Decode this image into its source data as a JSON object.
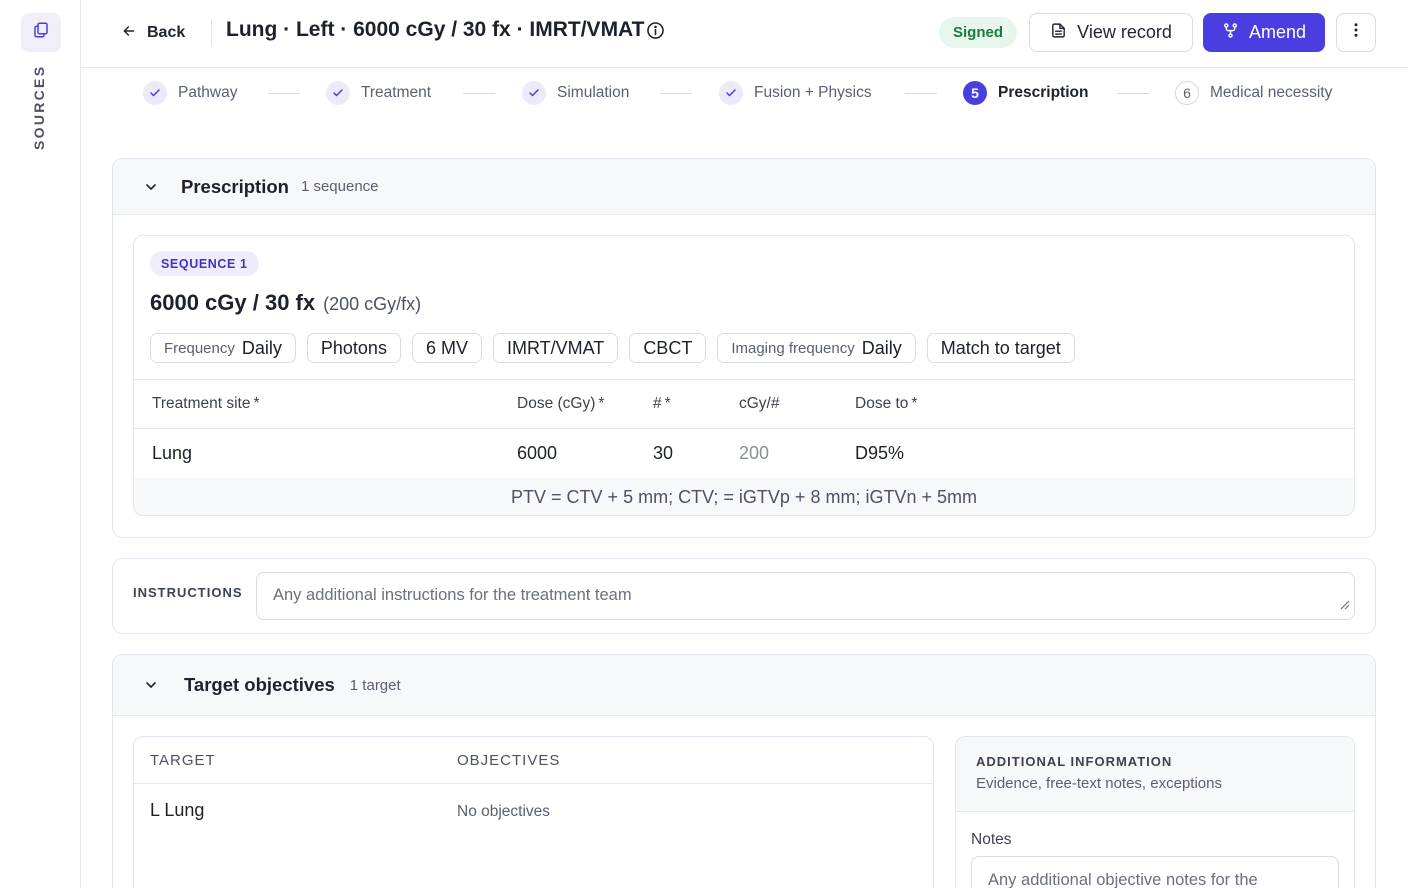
{
  "sidebar": {
    "label": "SOURCES",
    "icon": "copy-icon"
  },
  "header": {
    "back_label": "Back",
    "title": "Lung · Left · 6000 cGy / 30 fx · IMRT/VMAT",
    "status": "Signed",
    "view_record_label": "View record",
    "amend_label": "Amend"
  },
  "steps": [
    {
      "label": "Pathway",
      "state": "done"
    },
    {
      "label": "Treatment",
      "state": "done"
    },
    {
      "label": "Simulation",
      "state": "done"
    },
    {
      "label": "Fusion + Physics",
      "state": "done"
    },
    {
      "label": "Prescription",
      "number": "5",
      "state": "active"
    },
    {
      "label": "Medical necessity",
      "number": "6",
      "state": "pending"
    }
  ],
  "prescription": {
    "title": "Prescription",
    "count": "1 sequence",
    "sequence": {
      "badge": "SEQUENCE 1",
      "dose_title": "6000 cGy / 30 fx",
      "rate": "(200 cGy/fx)",
      "frequency_key": "Frequency",
      "frequency_value": "Daily",
      "chips": [
        "Photons",
        "6 MV",
        "IMRT/VMAT",
        "CBCT"
      ],
      "imaging_key": "Imaging frequency",
      "imaging_value": "Daily",
      "match": "Match to target",
      "columns": {
        "site": "Treatment site",
        "dose": "Dose (cGy)",
        "fractions": "#",
        "per_fraction": "cGy/#",
        "dose_to": "Dose to"
      },
      "row": {
        "site": "Lung",
        "dose": "6000",
        "fractions": "30",
        "per_fraction": "200",
        "dose_to": "D95%"
      },
      "note": "PTV = CTV + 5 mm; CTV; = iGTVp + 8 mm; iGTVn + 5mm"
    }
  },
  "instructions": {
    "label": "INSTRUCTIONS",
    "placeholder": "Any additional instructions for the treatment team"
  },
  "targets": {
    "title": "Target objectives",
    "count": "1 target",
    "col_target": "TARGET",
    "col_objectives": "OBJECTIVES",
    "rows": [
      {
        "target": "L Lung",
        "objectives": "No objectives"
      }
    ],
    "additional": {
      "title": "ADDITIONAL INFORMATION",
      "subtitle": "Evidence, free-text notes, exceptions",
      "notes_label": "Notes",
      "notes_placeholder": "Any additional objective notes for the"
    }
  },
  "colors": {
    "accent": "#4a3ee0",
    "signed_bg": "#e7f6ec",
    "signed_text": "#1d7a3f",
    "required": "#d33a3a"
  }
}
